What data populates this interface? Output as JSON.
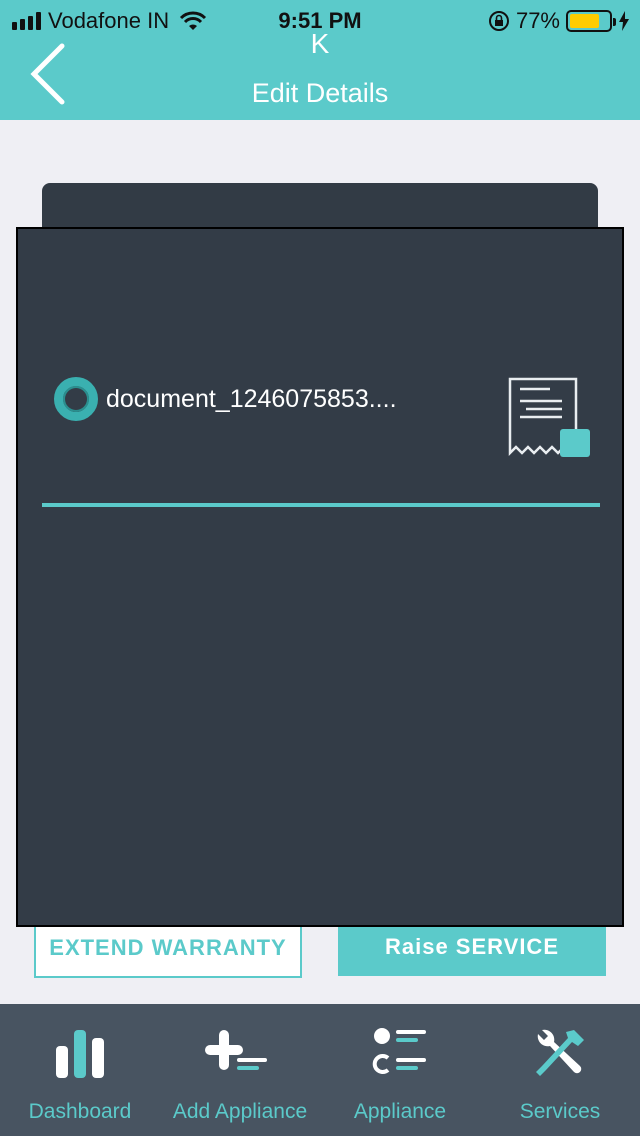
{
  "status_bar": {
    "carrier": "Vodafone IN",
    "time": "9:51 PM",
    "battery": "77%"
  },
  "header": {
    "subtitle_initial": "K",
    "title": "Edit Details"
  },
  "background": {
    "extend_warranty_label": "EXTEND WARRANTY",
    "raise_service_label": "Raise SERVICE"
  },
  "modal": {
    "document_name": "document_1246075853...."
  },
  "tabbar": {
    "items": [
      {
        "label": "Dashboard",
        "icon": "bar-chart-icon"
      },
      {
        "label": "Add Appliance",
        "icon": "add-list-icon"
      },
      {
        "label": "Appliance",
        "icon": "list-icon"
      },
      {
        "label": "Services",
        "icon": "tools-icon"
      }
    ]
  },
  "colors": {
    "accent": "#5bcaca",
    "modal_bg": "#333c47",
    "tabbar_bg": "#485461",
    "battery": "#ffcc00"
  }
}
